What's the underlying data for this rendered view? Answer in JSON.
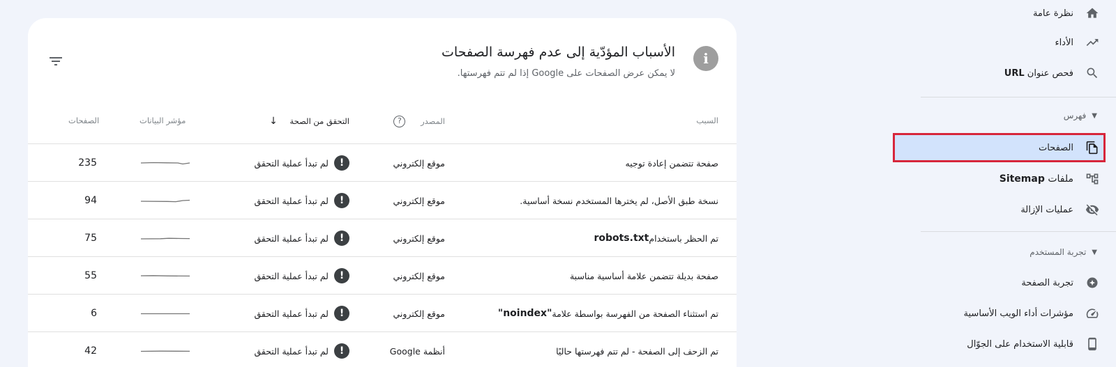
{
  "sidebar": {
    "items": [
      {
        "label": "نظرة عامة",
        "icon": "home-icon"
      },
      {
        "label": "الأداء",
        "icon": "trending-up-icon"
      },
      {
        "label": "فحص عنوان",
        "label_bold": "URL",
        "icon": "search-icon"
      }
    ],
    "index_section": "فهرس",
    "index_items": [
      {
        "label": "الصفحات",
        "icon": "pages-icon",
        "selected": true
      },
      {
        "label": "ملفات",
        "label_bold": "Sitemap",
        "icon": "sitemap-icon"
      },
      {
        "label": "عمليات الإزالة",
        "icon": "visibility-off-icon"
      }
    ],
    "experience_section": "تجربة المستخدم",
    "experience_items": [
      {
        "label": "تجربة الصفحة",
        "icon": "plus-circle-icon"
      },
      {
        "label": "مؤشرات أداء الويب الأساسية",
        "icon": "speed-icon"
      },
      {
        "label": "قابلية الاستخدام على الجوّال",
        "icon": "phone-icon"
      }
    ]
  },
  "card": {
    "title": "الأسباب المؤدّية إلى عدم فهرسة الصفحات",
    "subtitle": "لا يمكن عرض الصفحات على Google إذا لم تتم فهرستها.",
    "columns": {
      "reason": "السبب",
      "source": "المصدر",
      "validation": "التحقق من الصحة",
      "trend": "مؤشر البيانات",
      "pages": "الصفحات"
    },
    "rows": [
      {
        "reason": "صفحة تتضمن إعادة توجيه",
        "source": "موقع إلكتروني",
        "validation": "لم تبدأ عملية التحقق",
        "pages": "235"
      },
      {
        "reason": "نسخة طبق الأصل، لم يخترها المستخدم نسخة أساسية.",
        "source": "موقع إلكتروني",
        "validation": "لم تبدأ عملية التحقق",
        "pages": "94"
      },
      {
        "reason": "تم الحظر باستخدام ",
        "reason_bold": "robots.txt",
        "source": "موقع إلكتروني",
        "validation": "لم تبدأ عملية التحقق",
        "pages": "75"
      },
      {
        "reason": "صفحة بديلة تتضمن علامة أساسية مناسبة",
        "source": "موقع إلكتروني",
        "validation": "لم تبدأ عملية التحقق",
        "pages": "55"
      },
      {
        "reason": "تم استثناء الصفحة من الفهرسة بواسطة علامة ",
        "reason_bold": "\"noindex\"",
        "source": "موقع إلكتروني",
        "validation": "لم تبدأ عملية التحقق",
        "pages": "6"
      },
      {
        "reason": "تم الزحف إلى الصفحة - لم تتم فهرستها حاليًا",
        "source": "أنظمة Google",
        "validation": "لم تبدأ عملية التحقق",
        "pages": "42"
      }
    ]
  },
  "colors": {
    "background": "#f1f4fb",
    "selected": "#d2e3fc",
    "highlight_border": "#d7263b"
  }
}
